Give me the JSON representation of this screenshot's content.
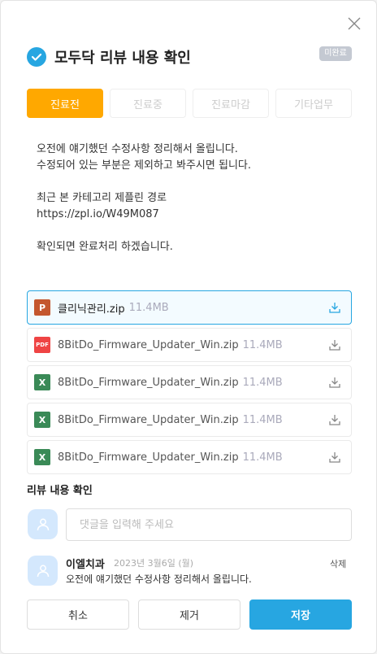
{
  "header": {
    "title": "모두닥 리뷰 내용 확인",
    "status_badge": "미완료"
  },
  "tabs": [
    {
      "label": "진료전"
    },
    {
      "label": "진료중"
    },
    {
      "label": "진료마감"
    },
    {
      "label": "기타업무"
    }
  ],
  "message": {
    "lines": [
      "오전에 얘기했던 수정사항 정리해서 올립니다.",
      "수정되어 있는 부분은 제외하고 봐주시면 됩니다.",
      "",
      "최근 본 카테고리 제플린 경로",
      "https://zpl.io/W49M087",
      "",
      "확인되면 완료처리 하겠습니다."
    ]
  },
  "files": [
    {
      "type": "P",
      "name": "클리닉관리.zip",
      "size": "11.4MB",
      "color": "#c4572e"
    },
    {
      "type": "PDF",
      "name": "8BitDo_Firmware_Updater_Win.zip",
      "size": "11.4MB",
      "color": "#ef4444"
    },
    {
      "type": "X",
      "name": "8BitDo_Firmware_Updater_Win.zip",
      "size": "11.4MB",
      "color": "#3a8a57"
    },
    {
      "type": "X",
      "name": "8BitDo_Firmware_Updater_Win.zip",
      "size": "11.4MB",
      "color": "#3a8a57"
    },
    {
      "type": "X",
      "name": "8BitDo_Firmware_Updater_Win.zip",
      "size": "11.4MB",
      "color": "#3a8a57"
    }
  ],
  "review": {
    "section_title": "리뷰 내용 확인",
    "input_placeholder": "댓글을 입력해 주세요",
    "comment": {
      "author": "이엘치과",
      "date": "2023년 3월6일 (월)",
      "text": "오전에 얘기했던 수정사항 정리해서 올립니다.",
      "delete_label": "삭제"
    }
  },
  "actions": {
    "cancel": "취소",
    "remove": "제거",
    "save": "저장"
  }
}
